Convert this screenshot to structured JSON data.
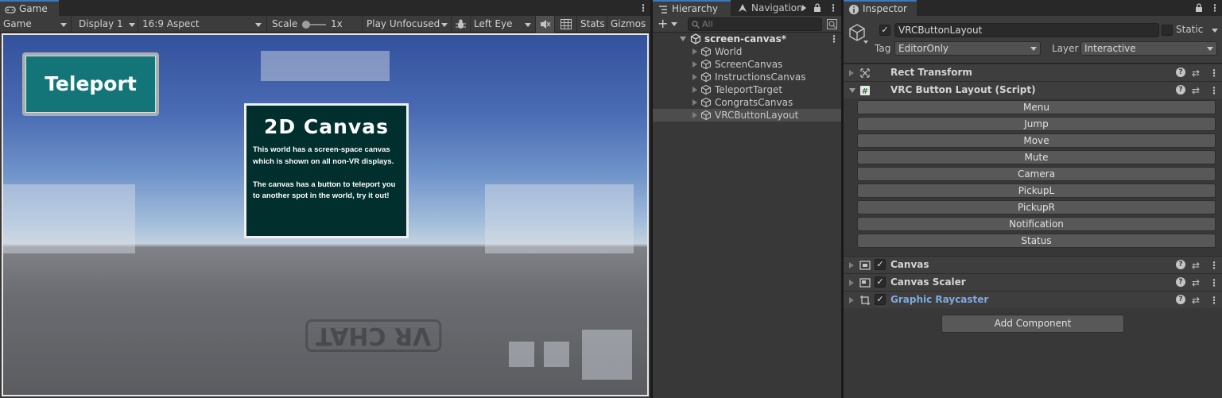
{
  "game": {
    "tab_label": "Game",
    "toolbar": {
      "mode": "Game",
      "display": "Display 1",
      "aspect": "16:9 Aspect",
      "scale_label": "Scale",
      "scale_value": "1x",
      "play_mode": "Play Unfocused",
      "eye": "Left Eye",
      "stats": "Stats",
      "gizmos": "Gizmos"
    },
    "scene": {
      "teleport_button": "Teleport",
      "card_title": "2D Canvas",
      "card_body": "This world has a screen-space canvas which is shown on all non-VR displays.\n\nThe canvas has a button to teleport you to another spot in the world, try it out!",
      "floor_text": "VR CHAT"
    }
  },
  "hierarchy": {
    "tab_label": "Hierarchy",
    "nav_tab_label": "Navigation",
    "search_placeholder": "All",
    "root": "screen-canvas*",
    "items": [
      {
        "label": "World",
        "selected": false
      },
      {
        "label": "ScreenCanvas",
        "selected": false
      },
      {
        "label": "InstructionsCanvas",
        "selected": false
      },
      {
        "label": "TeleportTarget",
        "selected": false
      },
      {
        "label": "CongratsCanvas",
        "selected": false
      },
      {
        "label": "VRCButtonLayout",
        "selected": true
      }
    ]
  },
  "inspector": {
    "tab_label": "Inspector",
    "object_name": "VRCButtonLayout",
    "static_label": "Static",
    "tag_label": "Tag",
    "tag_value": "EditorOnly",
    "layer_label": "Layer",
    "layer_value": "Interactive",
    "components": [
      {
        "title": "Rect Transform",
        "icon": "rect-transform-icon",
        "checkbox": false,
        "expanded": false
      },
      {
        "title": "VRC Button Layout (Script)",
        "icon": "script-icon",
        "checkbox": false,
        "expanded": true
      },
      {
        "title": "Canvas",
        "icon": "canvas-icon",
        "checkbox": true,
        "expanded": false
      },
      {
        "title": "Canvas Scaler",
        "icon": "canvas-scaler-icon",
        "checkbox": true,
        "expanded": false
      },
      {
        "title": "Graphic Raycaster",
        "icon": "graphic-raycaster-icon",
        "checkbox": true,
        "expanded": false
      }
    ],
    "layout_buttons": [
      "Menu",
      "Jump",
      "Move",
      "Mute",
      "Camera",
      "PickupL",
      "PickupR",
      "Notification",
      "Status"
    ],
    "add_component": "Add Component"
  },
  "colors": {
    "accent_tab": "#3a79bb",
    "teleport_button": "#137577",
    "card_bg": "#002f2e",
    "raycaster_title": "#7fa8e0"
  }
}
